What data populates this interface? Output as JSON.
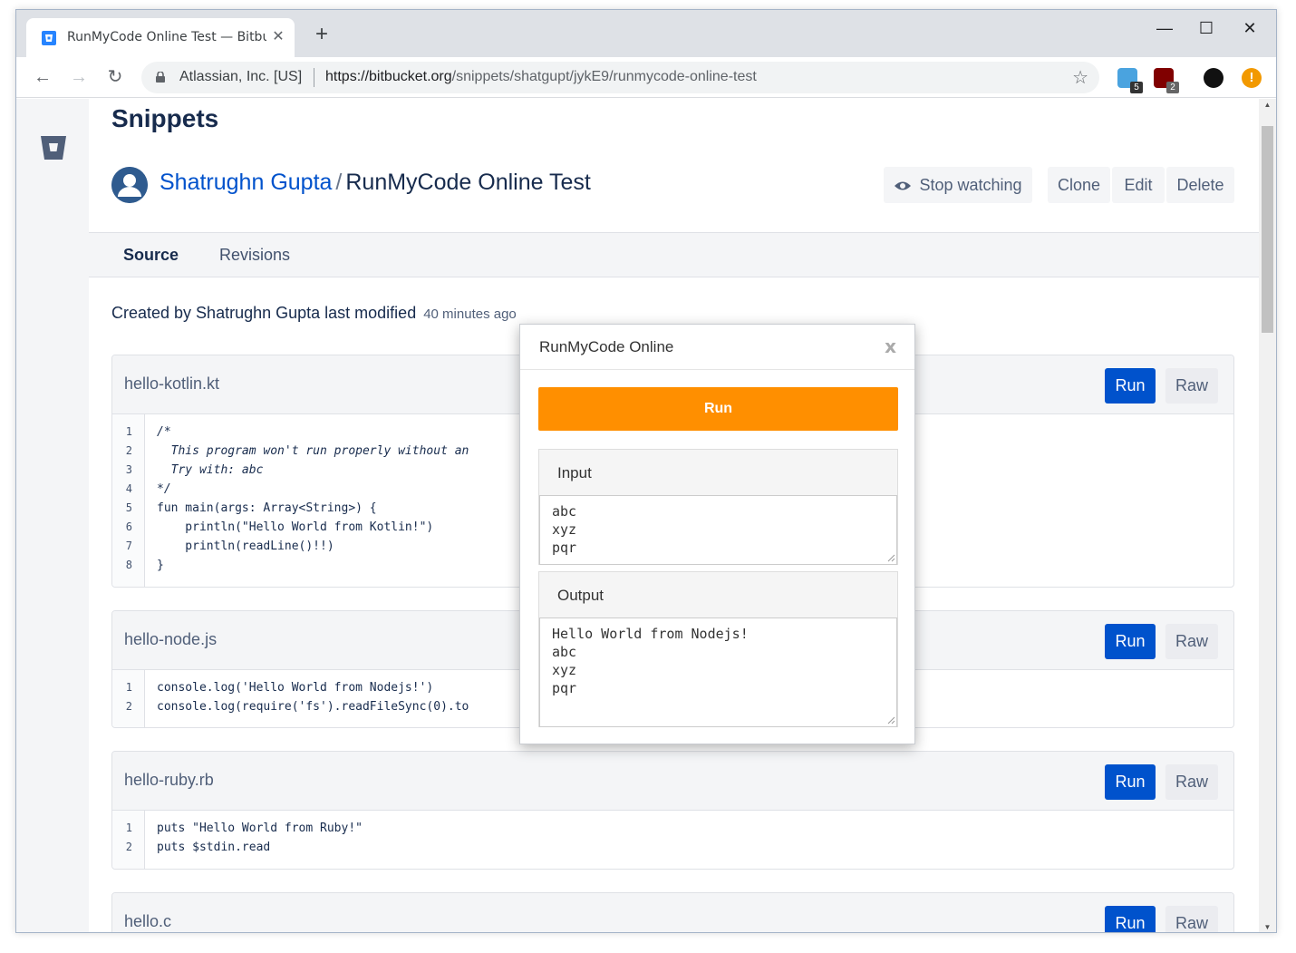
{
  "browser": {
    "tab_title": "RunMyCode Online Test — Bitbucket",
    "org": "Atlassian, Inc. [US]",
    "url_scheme_host": "https://bitbucket.org",
    "url_path": "/snippets/shatgupt/jykE9/runmycode-online-test",
    "ext_badge_1": "5",
    "ext_badge_2": "2",
    "colors": {
      "tabstrip": "#dee1e6",
      "accent": "#0052cc",
      "orange": "#ff8f00"
    }
  },
  "page": {
    "heading": "Snippets",
    "owner": "Shatrughn Gupta",
    "separator": "/",
    "snippet_name": "RunMyCode Online Test",
    "buttons": {
      "stop_watching": "Stop watching",
      "clone": "Clone",
      "edit": "Edit",
      "delete": "Delete"
    },
    "tabs": {
      "source": "Source",
      "revisions": "Revisions"
    },
    "meta_text": "Created by Shatrughn Gupta last modified",
    "meta_ago": "40 minutes ago",
    "run_label": "Run",
    "raw_label": "Raw"
  },
  "files": [
    {
      "name": "hello-kotlin.kt",
      "lines": [
        "/*",
        "  This program won't run properly without an",
        "  Try with: abc",
        "*/",
        "fun main(args: Array<String>) {",
        "    println(\"Hello World from Kotlin!\")",
        "    println(readLine()!!)",
        "}"
      ]
    },
    {
      "name": "hello-node.js",
      "lines": [
        "console.log('Hello World from Nodejs!')",
        "console.log(require('fs').readFileSync(0).to"
      ]
    },
    {
      "name": "hello-ruby.rb",
      "lines": [
        "puts \"Hello World from Ruby!\"",
        "puts $stdin.read"
      ]
    },
    {
      "name": "hello.c",
      "lines": []
    }
  ],
  "modal": {
    "title": "RunMyCode Online",
    "close": "x",
    "run": "Run",
    "input_label": "Input",
    "input_value": "abc\nxyz\npqr",
    "output_label": "Output",
    "output_value": "Hello World from Nodejs!\nabc\nxyz\npqr"
  }
}
